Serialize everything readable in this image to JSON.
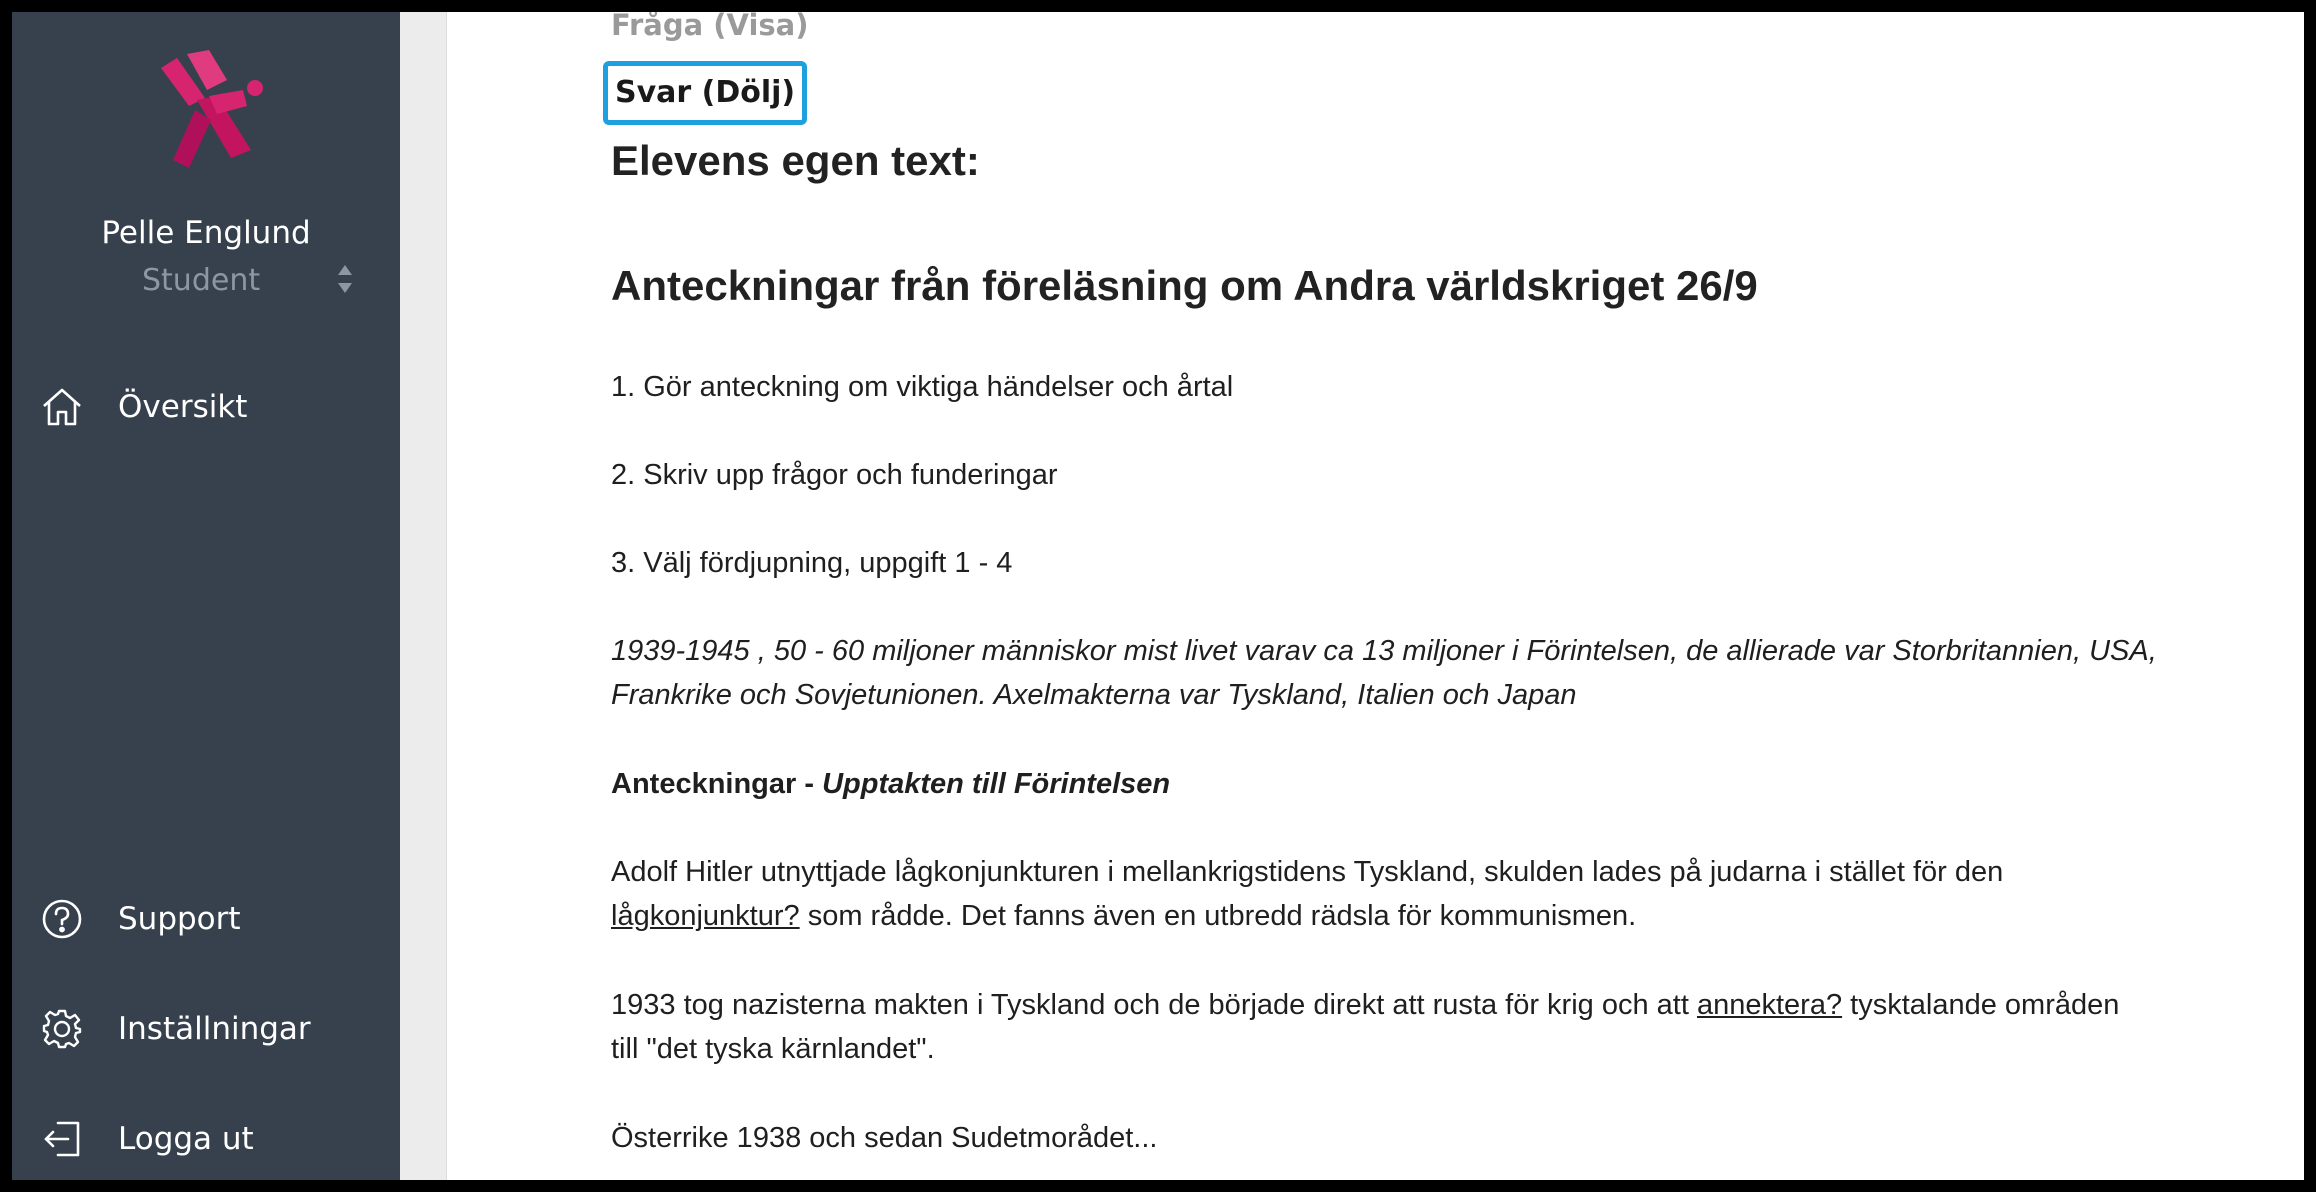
{
  "sidebar": {
    "user_name": "Pelle Englund",
    "user_role": "Student",
    "nav_top": [
      {
        "label": "Översikt",
        "icon": "home-icon"
      }
    ],
    "nav_bottom": [
      {
        "label": "Support",
        "icon": "help-circle-icon"
      },
      {
        "label": "Inställningar",
        "icon": "gear-icon"
      },
      {
        "label": "Logga ut",
        "icon": "logout-icon"
      }
    ],
    "logo_colors": {
      "primary": "#d6246e",
      "secondary": "#b0105a"
    }
  },
  "content": {
    "question_toggle": "Fråga (Visa)",
    "answer_toggle": "Svar (Dölj)",
    "section_heading": "Elevens egen text:",
    "title": "Anteckningar från föreläsning om Andra världskriget 26/9",
    "steps": [
      "1. Gör anteckning om viktiga händelser och årtal",
      "2. Skriv upp frågor och funderingar",
      "3. Välj fördjupning, uppgift 1 - 4"
    ],
    "summary_line1": "1939-1945 , 50 - 60 miljoner människor mist livet varav ca 13 miljoner i Förintelsen, de allierade var Storbritannien, USA,",
    "summary_line2": "Frankrike och Sovjetunionen. Axelmakterna var Tyskland, Italien och Japan",
    "notes_heading_bold": "Anteckningar - ",
    "notes_heading_italic": "Upptakten till Förintelsen",
    "para1_line1": "Adolf Hitler utnyttjade lågkonjunkturen i mellankrigstidens Tyskland, skulden lades på judarna i stället för den",
    "para1_link": "lågkonjunktur?",
    "para1_rest": " som rådde. Det fanns även en utbredd rädsla för kommunismen.",
    "para2_start": "1933 tog nazisterna makten i Tyskland och de började direkt att rusta för krig och att ",
    "para2_link": "annektera?",
    "para2_end": " tysktalande områden",
    "para2_line2": "till \"det tyska kärnlandet\".",
    "para3": "Österrike 1938 och sedan Sudetmorådet..."
  },
  "colors": {
    "sidebar_bg": "#37414d",
    "accent_focus": "#1e9fe0"
  }
}
